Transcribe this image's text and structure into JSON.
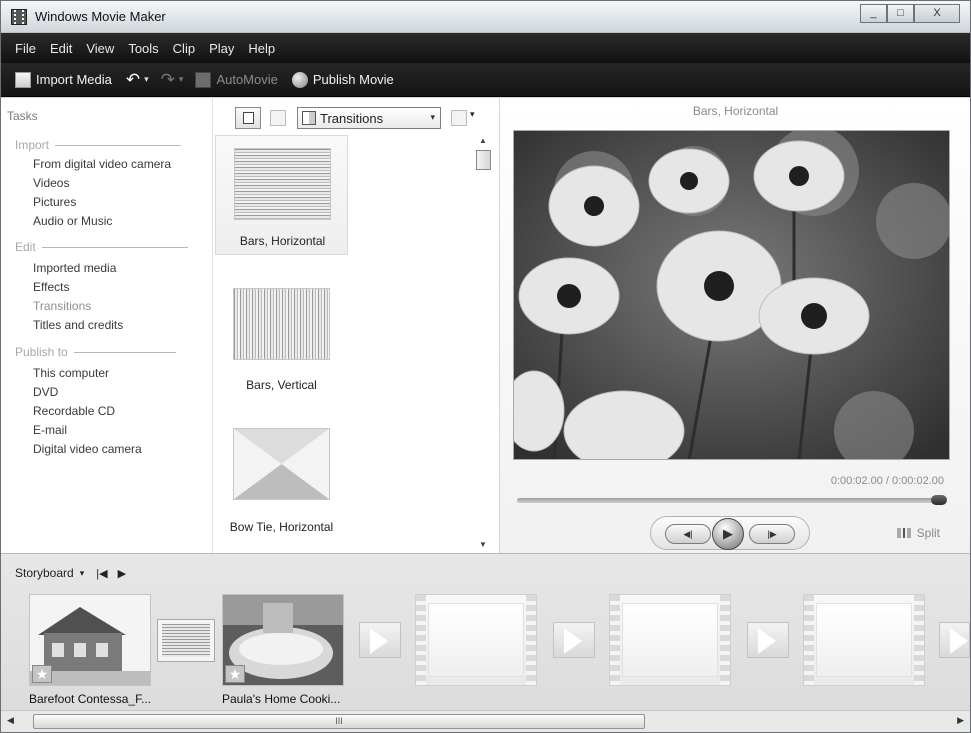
{
  "window": {
    "title": "Windows Movie Maker",
    "controls": [
      "_",
      "□",
      "X"
    ]
  },
  "menu": [
    "File",
    "Edit",
    "View",
    "Tools",
    "Clip",
    "Play",
    "Help"
  ],
  "toolbar": {
    "import_media": "Import Media",
    "undo_icon": "↶",
    "redo_icon": "↷",
    "dropdown_arrow": "▾",
    "automovie": "AutoMovie",
    "publish_movie": "Publish Movie"
  },
  "tasks": {
    "title": "Tasks",
    "import": {
      "heading": "Import",
      "items": [
        "From digital video camera",
        "Videos",
        "Pictures",
        "Audio or Music"
      ]
    },
    "edit": {
      "heading": "Edit",
      "items": [
        "Imported media",
        "Effects",
        "Transitions",
        "Titles and credits"
      ]
    },
    "publish": {
      "heading": "Publish to",
      "items": [
        "This computer",
        "DVD",
        "Recordable CD",
        "E-mail",
        "Digital video camera"
      ]
    }
  },
  "gallery": {
    "dropdown_value": "Transitions",
    "dropdown_arrow": "▾",
    "scroll_up": "▲",
    "scroll_down": "▼",
    "items": [
      "Bars, Horizontal",
      "Bars, Vertical",
      "Bow Tie, Horizontal"
    ]
  },
  "preview": {
    "title": "Bars, Horizontal",
    "timecode": "0:00:02.00 / 0:00:02.00",
    "prev_frame": "◀|",
    "play": "▶",
    "next_frame": "|▶",
    "split_label": "Split",
    "seek_fraction": 1.0
  },
  "storyboard": {
    "label": "Storyboard",
    "dd": "▾",
    "rewind": "|◀",
    "play": "▶",
    "clips": [
      "Barefoot Contessa_F...",
      "Paula's Home Cooki..."
    ],
    "star": "★"
  },
  "hscroll": {
    "left": "◀",
    "right": "▶",
    "grip": "III"
  }
}
